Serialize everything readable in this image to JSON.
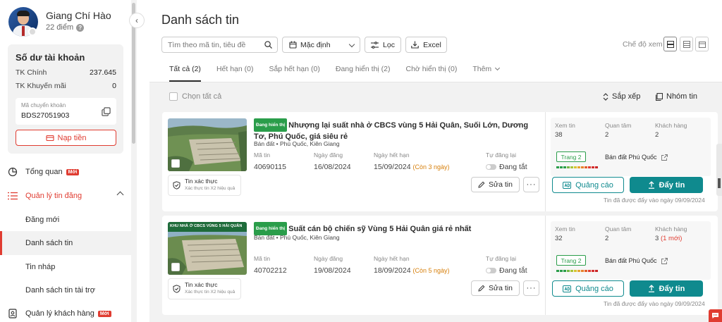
{
  "user": {
    "name": "Giang Chí Hào",
    "points": "22 điểm"
  },
  "balance": {
    "title": "Số dư tài khoản",
    "main_label": "TK Chính",
    "main_value": "237.645",
    "promo_label": "TK Khuyến mãi",
    "promo_value": "0",
    "transfer_label": "Mã chuyển khoản",
    "transfer_code": "BDS27051903",
    "topup_label": "Nạp tiền"
  },
  "nav": {
    "overview": "Tổng quan",
    "manage_listings": "Quản lý tin đăng",
    "new_post": "Đăng mới",
    "listings": "Danh sách tin",
    "drafts": "Tin nháp",
    "sponsored": "Danh sách tin tài trợ",
    "customers": "Quản lý khách hàng",
    "badge_new": "Mới"
  },
  "page": {
    "title": "Danh sách tin",
    "search_placeholder": "Tìm theo mã tin, tiêu đề",
    "sort_value": "Mặc định",
    "filter_label": "Lọc",
    "excel_label": "Excel",
    "view_mode_label": "Chế độ xem"
  },
  "tabs": [
    "Tất cả (2)",
    "Hết hạn (0)",
    "Sắp hết hạn (0)",
    "Đang hiển thị (2)",
    "Chờ hiển thị (0)",
    "Thêm"
  ],
  "list_toolbar": {
    "select_all": "Chọn tất cả",
    "sort": "Sắp xếp",
    "group": "Nhóm tin"
  },
  "labels": {
    "listing_id": "Mã tin",
    "posted_date": "Ngày đăng",
    "expiry_date": "Ngày hết hạn",
    "auto_repost": "Tự đăng lại",
    "auto_repost_state": "Đang tắt",
    "edit": "Sửa tin",
    "more": "···",
    "views": "Xem tin",
    "interest": "Quan tâm",
    "customers": "Khách hàng",
    "ads": "Quảng cáo",
    "push": "Đẩy tin",
    "verified": "Tin xác thực",
    "verified_sub": "Xác thực tin X2 hiệu quả",
    "vip": "Đang hiển thị"
  },
  "listings": [
    {
      "title": "Nhượng lại suất nhà ở CBCS vùng 5 Hải Quân, Suối Lớn, Dương Tơ, Phú Quốc, giá siêu rẻ",
      "category": "Bán đất • Phú Quốc, Kiên Giang",
      "id": "40690115",
      "posted": "16/08/2024",
      "expiry": "15/09/2024",
      "remaining": "(Còn 3 ngày)",
      "views": "38",
      "interest": "2",
      "customers": "2",
      "customers_new": "",
      "rank": "Trang 2",
      "rank_location": "Bán đất Phú Quốc",
      "pushed_note": "Tin đã được đẩy vào ngày 09/09/2024",
      "thumb_caption": ""
    },
    {
      "title": "Suất cán bộ chiến sỹ Vùng 5 Hải Quân giá rẻ nhất",
      "category": "Bán đất • Phú Quốc, Kiên Giang",
      "id": "40702212",
      "posted": "19/08/2024",
      "expiry": "18/09/2024",
      "remaining": "(Còn 5 ngày)",
      "views": "32",
      "interest": "2",
      "customers": "3",
      "customers_new": "(1 mới)",
      "rank": "Trang 2",
      "rank_location": "Bán đất Phú Quốc",
      "pushed_note": "Tin đã được đẩy vào ngày 09/09/2024",
      "thumb_caption": "KHU NHÀ Ở CBCS VÙNG 5 HẢI QUÂN"
    }
  ],
  "colors": {
    "accent_red": "#e03c31",
    "teal": "#0f8a8e",
    "green": "#2a9d4a"
  }
}
